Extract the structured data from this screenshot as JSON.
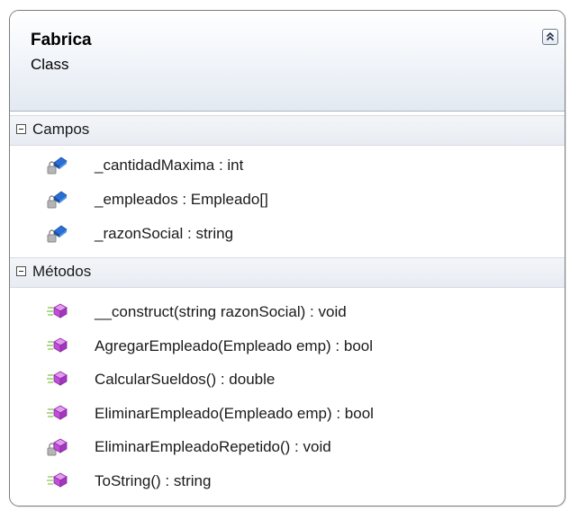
{
  "class": {
    "name": "Fabrica",
    "kind": "Class"
  },
  "sections": {
    "fields": {
      "label": "Campos",
      "items": [
        {
          "text": "_cantidadMaxima : int",
          "icon": "private-field-icon"
        },
        {
          "text": "_empleados : Empleado[]",
          "icon": "private-field-icon"
        },
        {
          "text": "_razonSocial : string",
          "icon": "private-field-icon"
        }
      ]
    },
    "methods": {
      "label": "Métodos",
      "items": [
        {
          "text": "__construct(string razonSocial) : void",
          "icon": "public-method-icon"
        },
        {
          "text": "AgregarEmpleado(Empleado emp) : bool",
          "icon": "public-method-icon"
        },
        {
          "text": "CalcularSueldos() : double",
          "icon": "public-method-icon"
        },
        {
          "text": "EliminarEmpleado(Empleado emp) : bool",
          "icon": "public-method-icon"
        },
        {
          "text": "EliminarEmpleadoRepetido() : void",
          "icon": "private-method-icon"
        },
        {
          "text": "ToString() : string",
          "icon": "public-method-icon"
        }
      ]
    }
  },
  "colors": {
    "field_icon": "#2a6fd6",
    "method_icon": "#c04fd8",
    "lock": "#8a8a8a"
  }
}
